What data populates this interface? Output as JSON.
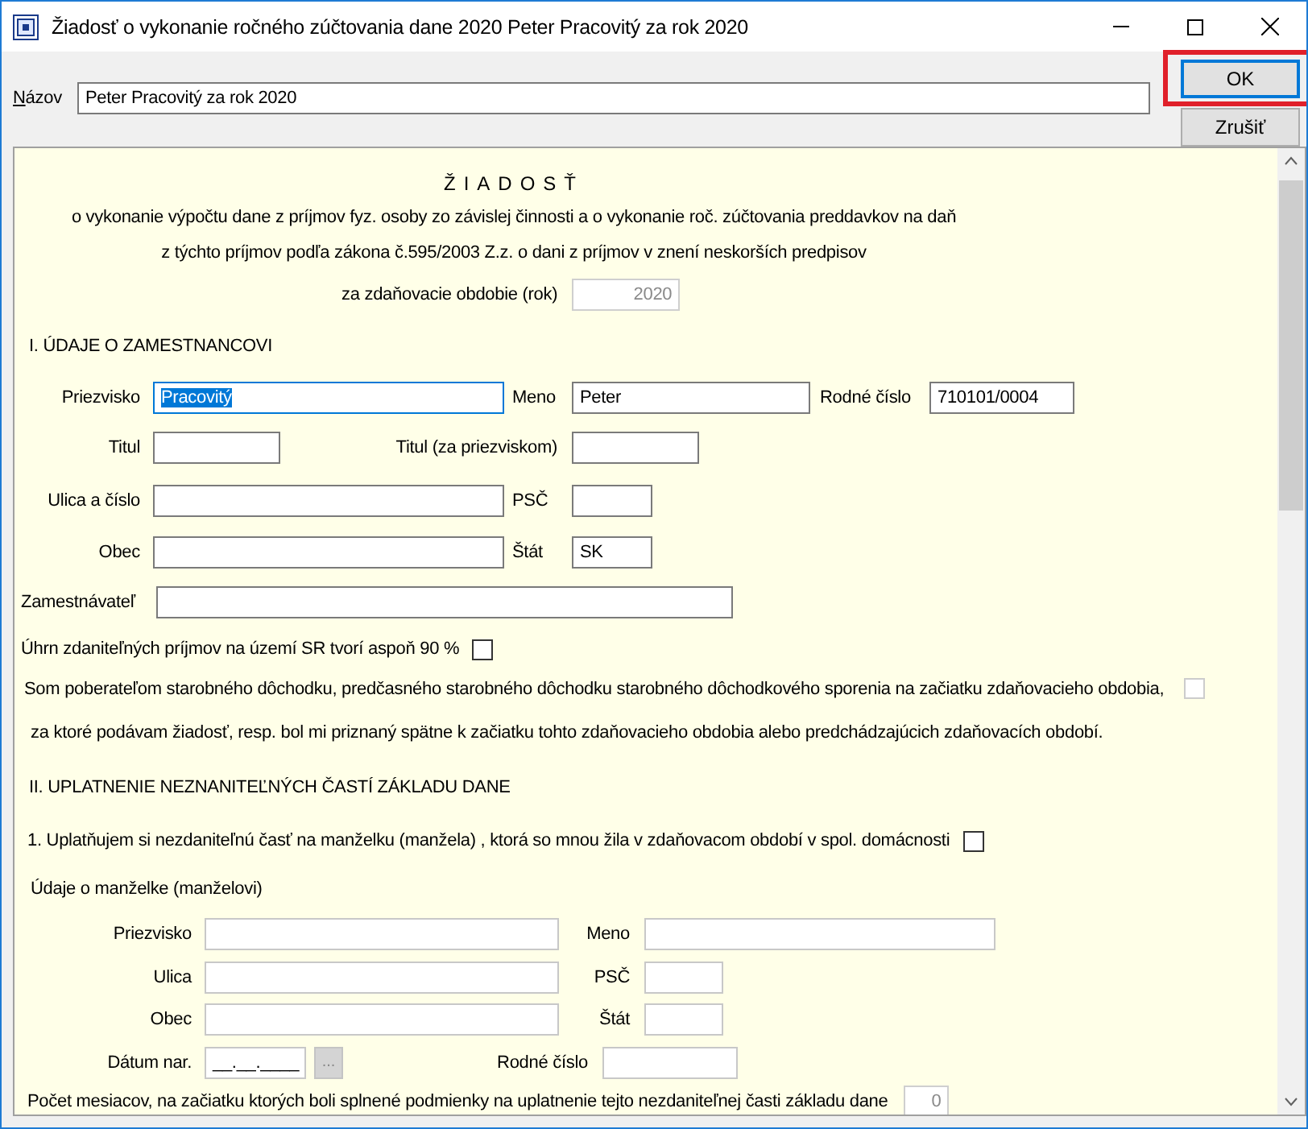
{
  "window": {
    "title": "Žiadosť o vykonanie ročného zúčtovania dane 2020 Peter Pracovitý za rok 2020"
  },
  "name_field": {
    "label": "Názov",
    "value": "Peter Pracovitý za rok 2020"
  },
  "buttons": [
    {
      "label": "OK",
      "highlighted": true
    },
    {
      "label": "Zrušiť",
      "highlighted": false
    }
  ],
  "form": {
    "heading": "ŽIADOSŤ",
    "intro": [
      "o vykonanie výpočtu dane z príjmov fyz. osoby zo závislej činnosti a o vykonanie roč. zúčtovania preddavkov na daň",
      "z týchto príjmov podľa zákona č.595/2003 Z.z. o dani z príjmov v znení neskorších predpisov"
    ],
    "year": {
      "label": "za zdaňovacie obdobie (rok)",
      "value": "2020",
      "disabled": true
    },
    "section_1": {
      "title": "I. ÚDAJE O ZAMESTNANCOVI",
      "fields": [
        {
          "label": "Priezvisko",
          "value": "Pracovitý",
          "focused": true
        },
        {
          "label": "Meno",
          "value": "Peter",
          "focused": false
        },
        {
          "label": "Rodné číslo",
          "value": "710101/0004",
          "focused": false
        },
        {
          "label": "Titul",
          "focused": false
        },
        {
          "label": "Titul (za priezviskom)",
          "focused": false
        },
        {
          "label": "Ulica a číslo",
          "focused": false
        },
        {
          "label": "PSČ",
          "focused": false
        },
        {
          "label": "Obec",
          "focused": false
        },
        {
          "label": "Štát",
          "value": "SK",
          "focused": false
        },
        {
          "label": "Zamestnávateľ",
          "focused": false
        }
      ],
      "checks": [
        {
          "lines": [
            "Úhrn zdaniteľných príjmov na území SR tvorí aspoň 90 %"
          ],
          "checked": false,
          "disabled": false
        },
        {
          "lines": [
            "Som poberateľom starobného dôchodku, predčasného starobného dôchodku starobného dôchodkového sporenia na začiatku zdaňovacieho obdobia,",
            "za ktoré podávam žiadosť, resp. bol mi priznaný spätne k začiatku tohto zdaňovacieho obdobia alebo predchádzajúcich zdaňovacích období."
          ],
          "checked": false,
          "disabled": true
        }
      ]
    },
    "section_2": {
      "title": "II. UPLATNENIE NEZNANITEĽNÝCH ČASTÍ ZÁKLADU DANE",
      "claim": {
        "label": "1. Uplatňujem si nezdaniteľnú časť na manželku (manžela) , ktorá so mnou žila v zdaňovacom období v spol. domácnosti",
        "checked": false
      },
      "subtitle": "Údaje o manželke (manželovi)",
      "fields": [
        {
          "label": "Priezvisko"
        },
        {
          "label": "Meno"
        },
        {
          "label": "Ulica"
        },
        {
          "label": "PSČ"
        },
        {
          "label": "Obec"
        },
        {
          "label": "Štát"
        },
        {
          "label": "Dátum nar.",
          "value": "__.__.____"
        },
        {
          "label": "Rodné číslo"
        }
      ],
      "picker_button": "...",
      "months": {
        "label": "Počet mesiacov, na začiatku ktorých boli splnené podmienky na uplatnenie tejto nezdaniteľnej časti základu dane",
        "value": "0",
        "disabled": true
      }
    }
  }
}
